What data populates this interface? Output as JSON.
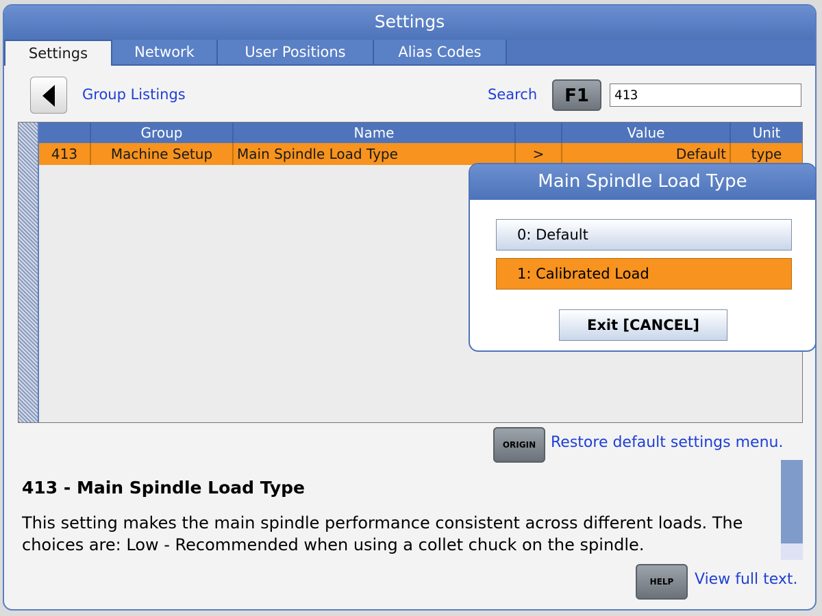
{
  "window": {
    "title": "Settings"
  },
  "tabs": [
    {
      "label": "Settings"
    },
    {
      "label": "Network"
    },
    {
      "label": "User Positions"
    },
    {
      "label": "Alias Codes"
    }
  ],
  "nav": {
    "group_listings_label": "Group Listings"
  },
  "search": {
    "label": "Search",
    "key_label": "F1",
    "value": "413"
  },
  "table": {
    "columns": [
      "",
      "Group",
      "Name",
      "",
      "Value",
      "Unit"
    ],
    "rows": [
      {
        "number": "413",
        "group": "Machine Setup",
        "name": "Main Spindle Load Type",
        "arrow": ">",
        "value": "Default",
        "unit": "type"
      }
    ]
  },
  "origin": {
    "key_label": "ORIGIN",
    "link_label": "Restore default settings menu."
  },
  "description": {
    "title": "413 - Main Spindle Load Type",
    "body": "This setting makes the main spindle performance consistent across different loads. The choices are: Low - Recommended when using a collet chuck on the spindle."
  },
  "help": {
    "key_label": "HELP",
    "link_label": "View full text."
  },
  "dialog": {
    "title": "Main Spindle Load Type",
    "options": [
      {
        "label": "0: Default"
      },
      {
        "label": "1: Calibrated Load"
      }
    ],
    "exit_label": "Exit [CANCEL]"
  },
  "colors": {
    "accent_blue": "#4f74bb",
    "selection_orange": "#f7931e",
    "link_blue": "#1f3fd6"
  }
}
